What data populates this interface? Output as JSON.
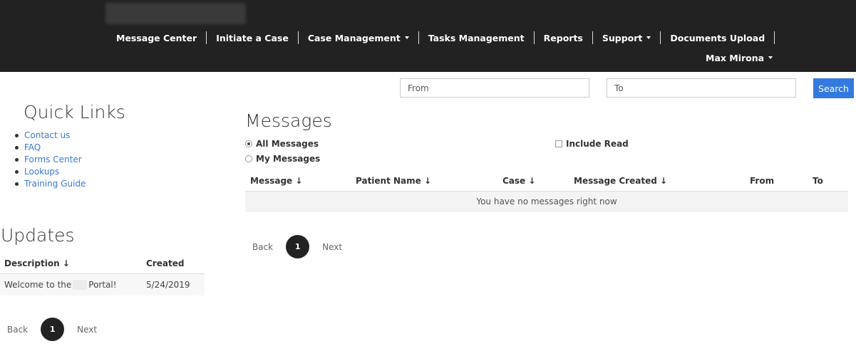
{
  "nav": {
    "items": [
      {
        "label": "Message Center",
        "dropdown": false
      },
      {
        "label": "Initiate a Case",
        "dropdown": false
      },
      {
        "label": "Case Management",
        "dropdown": true
      },
      {
        "label": "Tasks Management",
        "dropdown": false
      },
      {
        "label": "Reports",
        "dropdown": false
      },
      {
        "label": "Support",
        "dropdown": true
      },
      {
        "label": "Documents Upload",
        "dropdown": false
      }
    ],
    "user": "Max Mirona"
  },
  "search": {
    "from_placeholder": "From",
    "to_placeholder": "To",
    "button": "Search"
  },
  "quick_links": {
    "title": "Quick Links",
    "items": [
      "Contact us",
      "FAQ",
      "Forms Center",
      "Lookups",
      "Training Guide"
    ]
  },
  "updates": {
    "title": "Updates",
    "columns": [
      "Description ↓",
      "Created"
    ],
    "rows": [
      {
        "desc_before": "Welcome to the",
        "desc_after": "Portal!",
        "created": "5/24/2019"
      }
    ],
    "pager": {
      "back": "Back",
      "page": "1",
      "next": "Next"
    }
  },
  "messages": {
    "title": "Messages",
    "filter_all": "All Messages",
    "filter_mine": "My Messages",
    "include_read": "Include Read",
    "columns": [
      "Message ↓",
      "Patient Name ↓",
      "Case ↓",
      "Message Created ↓",
      "From",
      "To"
    ],
    "empty_text": "You have no messages right now",
    "pager": {
      "back": "Back",
      "page": "1",
      "next": "Next"
    }
  },
  "colors": {
    "navbar": "#222222",
    "accent": "#337ae0",
    "link": "#3b78d4"
  }
}
